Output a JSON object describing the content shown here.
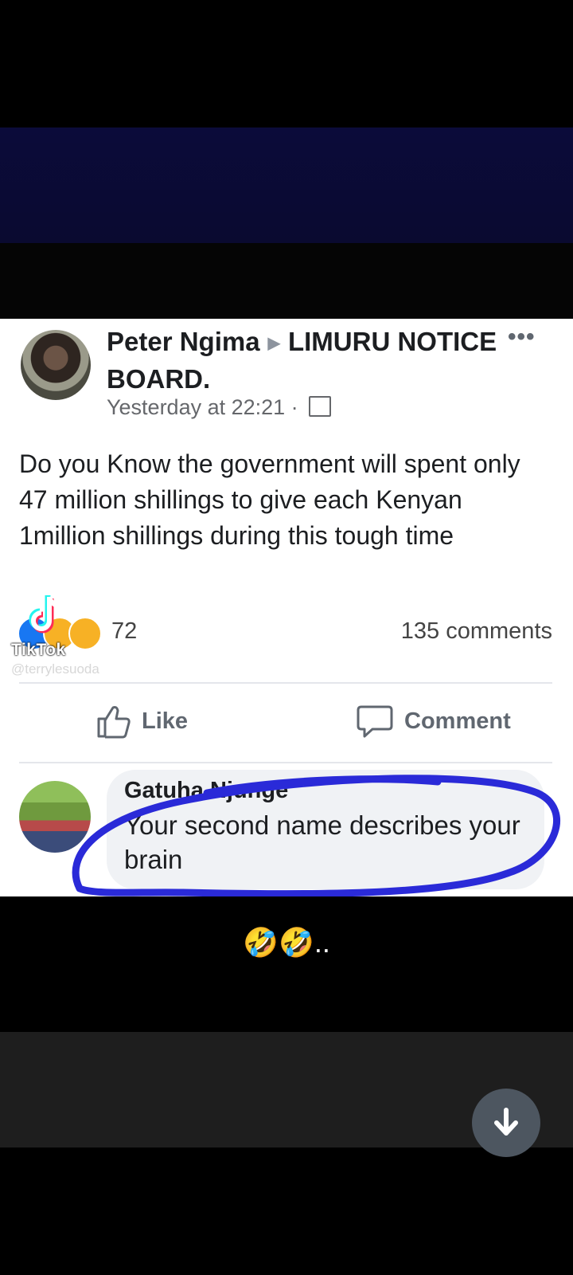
{
  "post": {
    "author_name": "Peter Ngima",
    "group_name": "LIMURU NOTICE BOARD.",
    "timestamp": "Yesterday at 22:21 ·",
    "more_label": "•••",
    "body": "Do you Know the government will spent only 47 million shillings to give each Kenyan 1million shillings during this tough time",
    "reaction_count": "72",
    "comment_count": "135 comments",
    "like_label": "Like",
    "comment_label": "Comment"
  },
  "comment": {
    "author_name": "Gatuha Njunge",
    "text": "Your second name describes your brain"
  },
  "watermark": {
    "brand": "TikTok",
    "handle": "@terrylesuoda"
  },
  "caption": "🤣🤣..",
  "colors": {
    "highlight_scribble": "#2a2ad8",
    "card_background": "#ffffff",
    "navy_band": "#0b0b3a"
  }
}
